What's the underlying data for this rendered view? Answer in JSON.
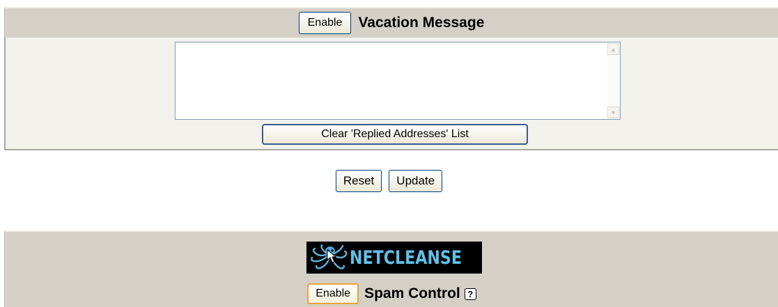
{
  "vacation": {
    "enable_label": "Enable",
    "title": "Vacation Message",
    "message_value": "",
    "clear_label": "Clear 'Replied Addresses' List"
  },
  "actions": {
    "reset_label": "Reset",
    "update_label": "Update"
  },
  "spam": {
    "logo_text": "NETCLEANSE",
    "enable_label": "Enable",
    "title": "Spam Control",
    "help_glyph": "?"
  },
  "colors": {
    "section_bg": "#d4d0c8",
    "body_bg": "#f2f1ec",
    "logo_bg": "#000000",
    "logo_text": "#5fc0e8"
  }
}
